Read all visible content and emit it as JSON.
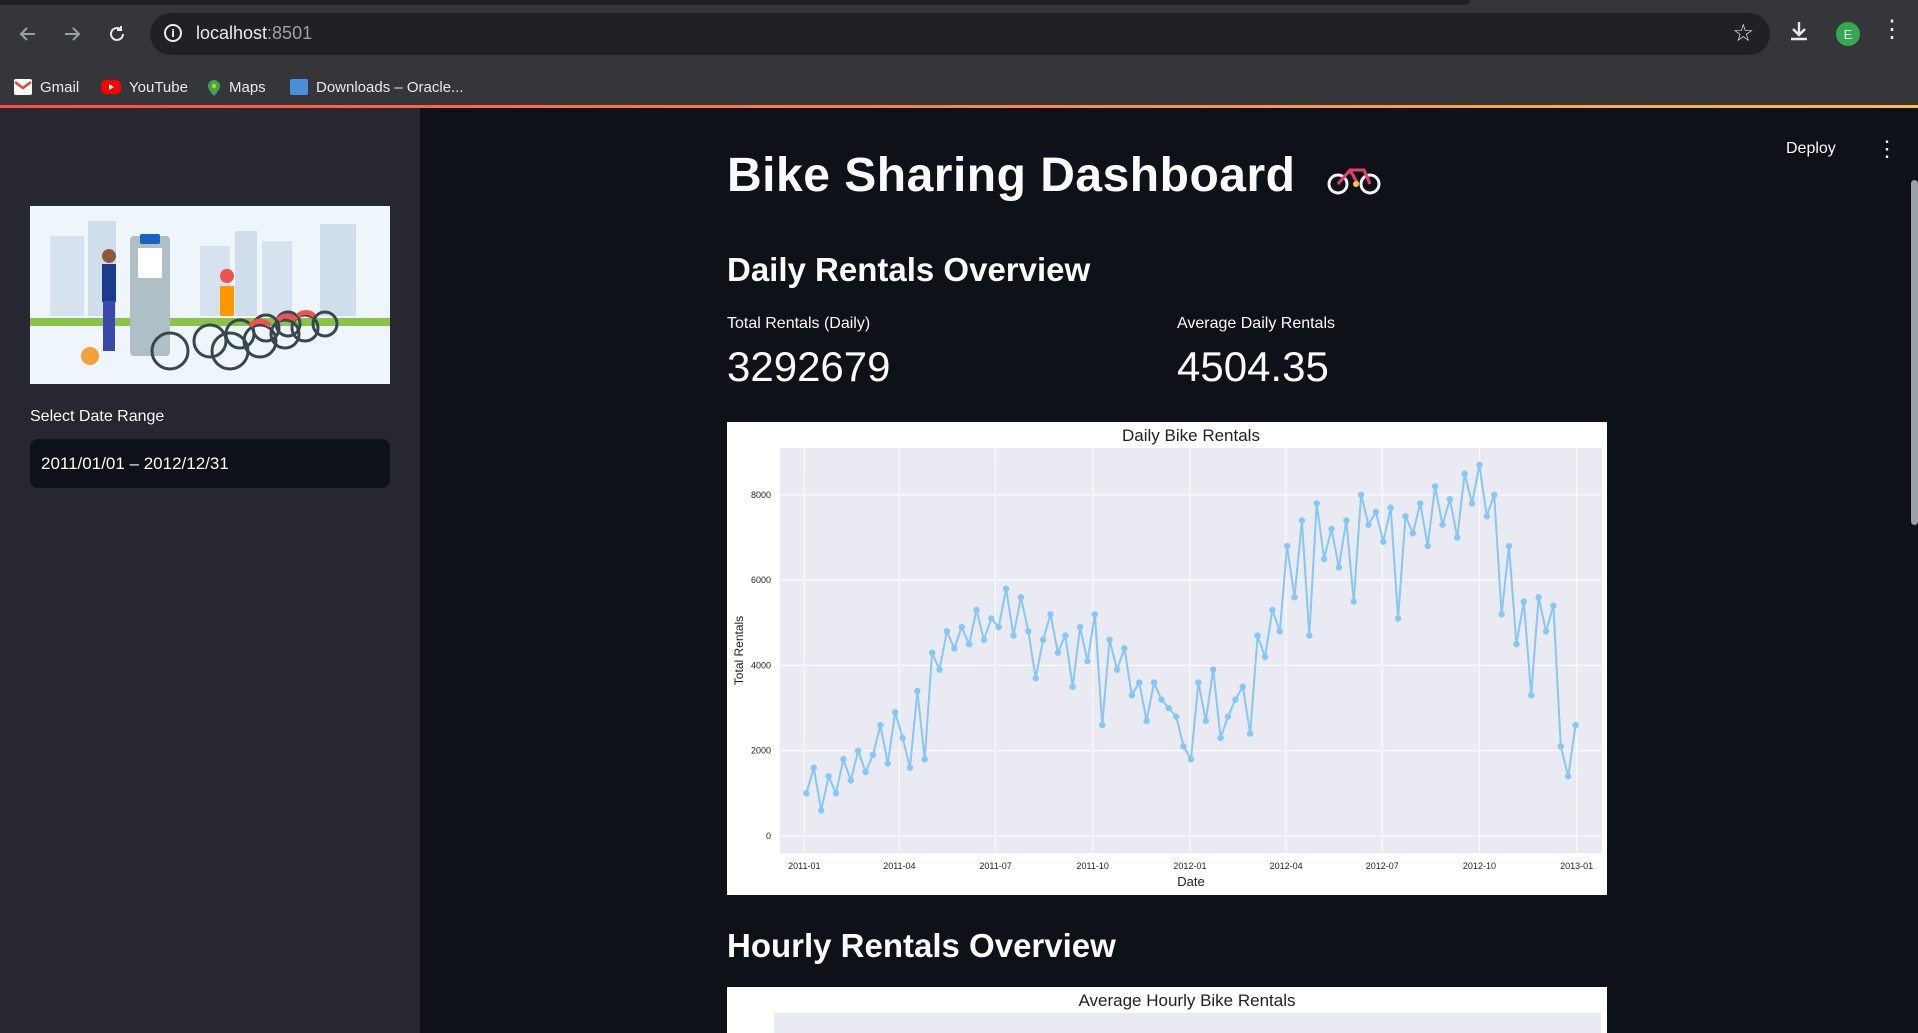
{
  "browser": {
    "url_host": "localhost",
    "url_port": ":8501",
    "profile_initial": "E",
    "bookmarks": [
      {
        "label": "Gmail",
        "icon": "gmail-icon"
      },
      {
        "label": "YouTube",
        "icon": "youtube-icon"
      },
      {
        "label": "Maps",
        "icon": "maps-icon"
      },
      {
        "label": "Downloads – Oracle...",
        "icon": "oracle-downloads-icon"
      }
    ]
  },
  "app": {
    "deploy_label": "Deploy",
    "title": "Bike Sharing Dashboard",
    "title_emoji": "bicycle-icon"
  },
  "sidebar": {
    "date_range_label": "Select Date Range",
    "date_range_value": "2011/01/01 – 2012/12/31"
  },
  "daily": {
    "section_title": "Daily Rentals Overview",
    "metrics": [
      {
        "label": "Total Rentals (Daily)",
        "value": "3292679"
      },
      {
        "label": "Average Daily Rentals",
        "value": "4504.35"
      }
    ]
  },
  "hourly": {
    "section_title": "Hourly Rentals Overview"
  },
  "chart_data": [
    {
      "type": "line",
      "title": "Daily Bike Rentals",
      "xlabel": "Date",
      "ylabel": "Total Rentals",
      "x_ticks": [
        "2011-01",
        "2011-04",
        "2011-07",
        "2011-10",
        "2012-01",
        "2012-04",
        "2012-07",
        "2012-10",
        "2013-01"
      ],
      "y_ticks": [
        0,
        2000,
        4000,
        6000,
        8000
      ],
      "ylim": [
        -400,
        9100
      ],
      "grid": true,
      "marker": "circle",
      "color": "#87c7f5",
      "background": "#eaeaf2",
      "x": [
        "2011-01-03",
        "2011-01-10",
        "2011-01-17",
        "2011-01-24",
        "2011-01-31",
        "2011-02-07",
        "2011-02-14",
        "2011-02-21",
        "2011-02-28",
        "2011-03-07",
        "2011-03-14",
        "2011-03-21",
        "2011-03-28",
        "2011-04-04",
        "2011-04-11",
        "2011-04-18",
        "2011-04-25",
        "2011-05-02",
        "2011-05-09",
        "2011-05-16",
        "2011-05-23",
        "2011-05-30",
        "2011-06-06",
        "2011-06-13",
        "2011-06-20",
        "2011-06-27",
        "2011-07-04",
        "2011-07-11",
        "2011-07-18",
        "2011-07-25",
        "2011-08-01",
        "2011-08-08",
        "2011-08-15",
        "2011-08-22",
        "2011-08-29",
        "2011-09-05",
        "2011-09-12",
        "2011-09-19",
        "2011-09-26",
        "2011-10-03",
        "2011-10-10",
        "2011-10-17",
        "2011-10-24",
        "2011-10-31",
        "2011-11-07",
        "2011-11-14",
        "2011-11-21",
        "2011-11-28",
        "2011-12-05",
        "2011-12-12",
        "2011-12-19",
        "2011-12-26",
        "2012-01-02",
        "2012-01-09",
        "2012-01-16",
        "2012-01-23",
        "2012-01-30",
        "2012-02-06",
        "2012-02-13",
        "2012-02-20",
        "2012-02-27",
        "2012-03-05",
        "2012-03-12",
        "2012-03-19",
        "2012-03-26",
        "2012-04-02",
        "2012-04-09",
        "2012-04-16",
        "2012-04-23",
        "2012-04-30",
        "2012-05-07",
        "2012-05-14",
        "2012-05-21",
        "2012-05-28",
        "2012-06-04",
        "2012-06-11",
        "2012-06-18",
        "2012-06-25",
        "2012-07-02",
        "2012-07-09",
        "2012-07-16",
        "2012-07-23",
        "2012-07-30",
        "2012-08-06",
        "2012-08-13",
        "2012-08-20",
        "2012-08-27",
        "2012-09-03",
        "2012-09-10",
        "2012-09-17",
        "2012-09-24",
        "2012-10-01",
        "2012-10-08",
        "2012-10-15",
        "2012-10-22",
        "2012-10-29",
        "2012-11-05",
        "2012-11-12",
        "2012-11-19",
        "2012-11-26",
        "2012-12-03",
        "2012-12-10",
        "2012-12-17",
        "2012-12-24",
        "2012-12-31"
      ],
      "values": [
        1000,
        1600,
        600,
        1400,
        1000,
        1800,
        1300,
        2000,
        1500,
        1900,
        2600,
        1700,
        2900,
        2300,
        1600,
        3400,
        1800,
        4300,
        3900,
        4800,
        4400,
        4900,
        4500,
        5300,
        4600,
        5100,
        4900,
        5800,
        4700,
        5600,
        4800,
        3700,
        4600,
        5200,
        4300,
        4700,
        3500,
        4900,
        4100,
        5200,
        2600,
        4600,
        3900,
        4400,
        3300,
        3600,
        2700,
        3600,
        3200,
        3000,
        2800,
        2100,
        1800,
        3600,
        2700,
        3900,
        2300,
        2800,
        3200,
        3500,
        2400,
        4700,
        4200,
        5300,
        4800,
        6800,
        5600,
        7400,
        4700,
        7800,
        6500,
        7200,
        6300,
        7400,
        5500,
        8000,
        7300,
        7600,
        6900,
        7700,
        5100,
        7500,
        7100,
        7800,
        6800,
        8200,
        7300,
        7900,
        7000,
        8500,
        7800,
        8700,
        7500,
        8000,
        5200,
        6800,
        4500,
        5500,
        3300,
        5600,
        4800,
        5400,
        2100,
        1400,
        2600
      ]
    },
    {
      "type": "bar",
      "title": "Average Hourly Bike Rentals"
    }
  ]
}
